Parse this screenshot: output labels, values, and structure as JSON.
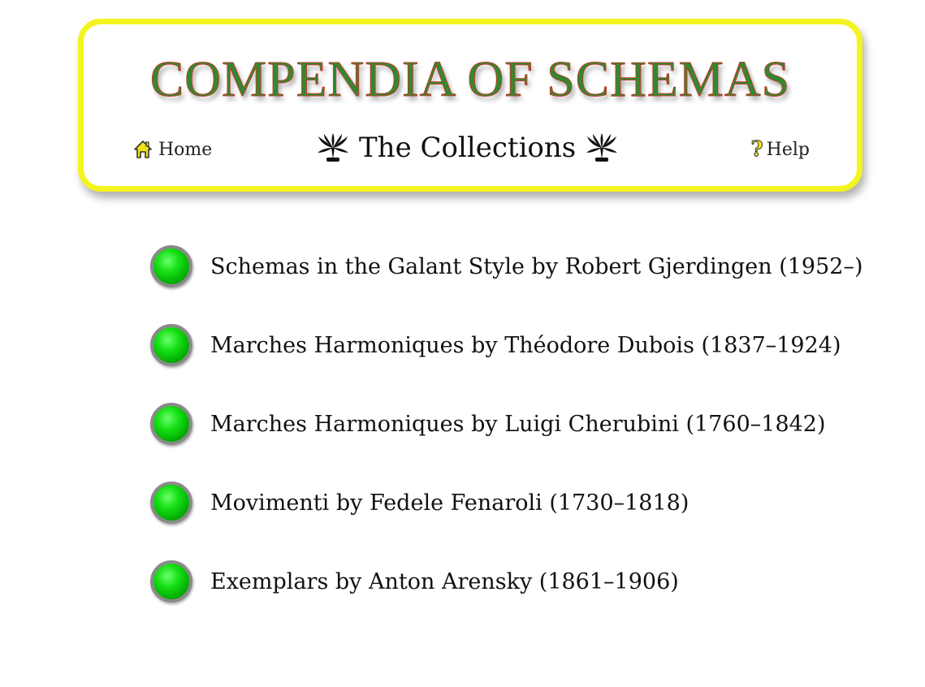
{
  "header": {
    "title": "COMPENDIA OF SCHEMAS",
    "nav": {
      "home_label": "Home",
      "center_label": "The Collections",
      "help_label": "Help",
      "home_icon": "home-icon",
      "help_icon": "help-icon",
      "ornament_icon": "palm-ornament-icon"
    }
  },
  "collections": [
    {
      "label": "Schemas in the Galant Style by Robert Gjerdingen (1952–)"
    },
    {
      "label": "Marches Harmoniques by Théodore Dubois (1837–1924)"
    },
    {
      "label": "Marches Harmoniques by Luigi Cherubini (1760–1842)"
    },
    {
      "label": "Movimenti by Fedele Fenaroli (1730–1818)"
    },
    {
      "label": "Exemplars by Anton Arensky (1861–1906)"
    }
  ],
  "colors": {
    "frame": "#f4f41e",
    "title_fill": "#2f8a2f",
    "title_outline": "#c0392b",
    "bullet": "#00c000"
  }
}
